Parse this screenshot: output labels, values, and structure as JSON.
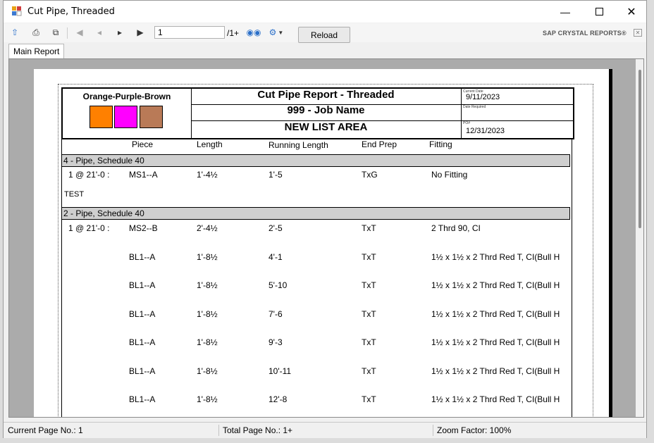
{
  "window": {
    "title": "Cut Pipe, Threaded"
  },
  "toolbar": {
    "page_value": "1",
    "page_total": "/1+",
    "reload_label": "Reload",
    "brand": "SAP CRYSTAL REPORTS®"
  },
  "tabs": {
    "main": "Main Report"
  },
  "report": {
    "company": "Orange-Purple-Brown",
    "swatches": [
      "#ff8000",
      "#ff00ff",
      "#b97a57"
    ],
    "title": "Cut Pipe Report - Threaded",
    "job": "999 - Job Name",
    "area": "NEW LIST AREA",
    "current_date_label": "Current Date",
    "current_date": "9/11/2023",
    "date_required_label": "Date Required",
    "po_label": "PO#",
    "po_date": "12/31/2023",
    "columns": {
      "piece": "Piece",
      "length": "Length",
      "running": "Running Length",
      "end_prep": "End Prep",
      "fitting": "Fitting"
    },
    "group1": {
      "header": "4 - Pipe, Schedule 40",
      "qty": "1 @ 21'-0 :",
      "rows": [
        {
          "piece": "MS1--A",
          "length": "1'-4½",
          "running": "1'-5",
          "end": "TxG",
          "fitting": "No Fitting"
        }
      ],
      "note": "TEST"
    },
    "group2": {
      "header": "2 - Pipe, Schedule 40",
      "qty": "1 @ 21'-0 :",
      "rows": [
        {
          "piece": "MS2--B",
          "length": "2'-4½",
          "running": "2'-5",
          "end": "TxT",
          "fitting": "2 Thrd 90, CI"
        },
        {
          "piece": "BL1--A",
          "length": "1'-8½",
          "running": "4'-1",
          "end": "TxT",
          "fitting": "1½ x 1½ x 2 Thrd Red T, CI(Bull H"
        },
        {
          "piece": "BL1--A",
          "length": "1'-8½",
          "running": "5'-10",
          "end": "TxT",
          "fitting": "1½ x 1½ x 2 Thrd Red T, CI(Bull H"
        },
        {
          "piece": "BL1--A",
          "length": "1'-8½",
          "running": "7'-6",
          "end": "TxT",
          "fitting": "1½ x 1½ x 2 Thrd Red T, CI(Bull H"
        },
        {
          "piece": "BL1--A",
          "length": "1'-8½",
          "running": "9'-3",
          "end": "TxT",
          "fitting": "1½ x 1½ x 2 Thrd Red T, CI(Bull H"
        },
        {
          "piece": "BL1--A",
          "length": "1'-8½",
          "running": "10'-11",
          "end": "TxT",
          "fitting": "1½ x 1½ x 2 Thrd Red T, CI(Bull H"
        },
        {
          "piece": "BL1--A",
          "length": "1'-8½",
          "running": "12'-8",
          "end": "TxT",
          "fitting": "1½ x 1½ x 2 Thrd Red T, CI(Bull H"
        }
      ]
    }
  },
  "status": {
    "current_page": "Current Page No.: 1",
    "total_page": "Total Page No.: 1+",
    "zoom": "Zoom Factor: 100%"
  },
  "colors": {
    "band": "#cfcfcf",
    "titlebar": "#ffffff",
    "chrome": "#f0f0f0"
  }
}
